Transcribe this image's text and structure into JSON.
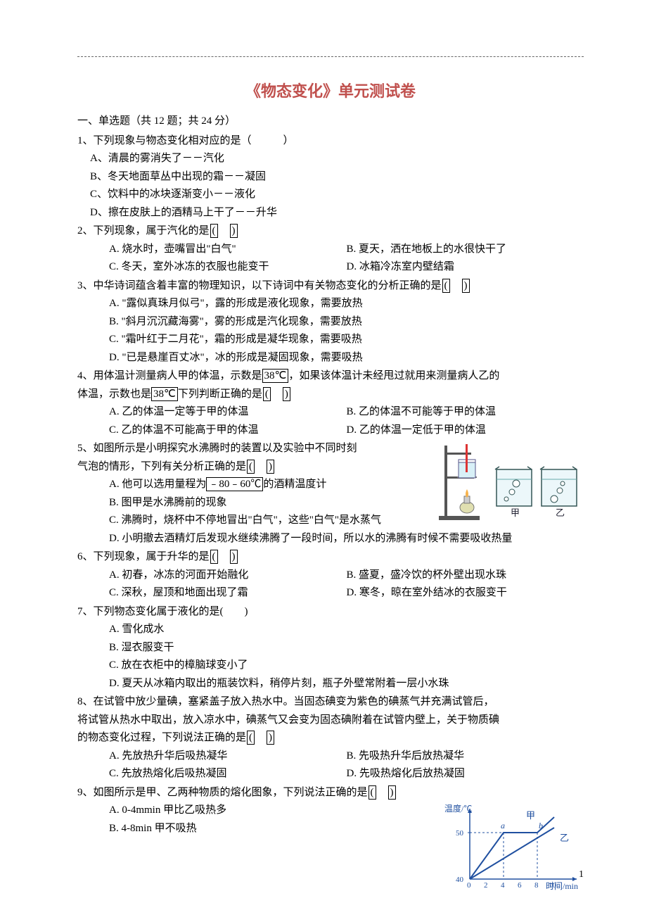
{
  "title": "《物态变化》单元测试卷",
  "section1": "一、单选题（共 12 题；共 24 分）",
  "q1": {
    "stem": "1、下列现象与物态变化相对应的是（　　　）",
    "a": "A、清晨的雾消失了－－汽化",
    "b": "B、冬天地面草丛中出现的霜－－凝固",
    "c": "C、饮料中的冰块逐渐变小－－液化",
    "d": "D、擦在皮肤上的酒精马上干了－－升华"
  },
  "q2": {
    "stem_pre": "2、下列现象，属于汽化的是",
    "a": "A. 烧水时，壶嘴冒出\"白气\"",
    "b": "B. 夏天，洒在地板上的水很快干了",
    "c": "C. 冬天，室外冰冻的衣服也能变干",
    "d": "D. 冰箱冷冻室内壁结霜"
  },
  "q3": {
    "stem_pre": "3、中华诗词蕴含着丰富的物理知识，以下诗词中有关物态变化的分析正确的是",
    "a": "A. \"露似真珠月似弓\"，露的形成是液化现象，需要放热",
    "b": "B. \"斜月沉沉藏海雾\"，雾的形成是汽化现象，需要放热",
    "c": "C. \"霜叶红于二月花\"，霜的形成是凝华现象，需要吸热",
    "d": "D. \"已是悬崖百丈冰\"，冰的形成是凝固现象，需要吸热"
  },
  "q4": {
    "stem_pre1": "4、用体温计测量病人甲的体温，示数是",
    "temp1": "38℃",
    "stem_mid1": "，如果该体温计未经甩过就用来测量病人乙的",
    "stem_pre2": "体温，示数也是",
    "temp2": "38℃",
    "stem_mid2": "下列判断正确的是",
    "a": "A. 乙的体温一定等于甲的体温",
    "b": "B. 乙的体温不可能等于甲的体温",
    "c": "C. 乙的体温不可能高于甲的体温",
    "d": "D. 乙的体温一定低于甲的体温"
  },
  "q5": {
    "stem1": "5、如图所示是小明探究水沸腾时的装置以及实验中不同时刻",
    "stem2_pre": "气泡的情形，下列有关分析正确的是",
    "a_pre": "A. 他可以选用量程为",
    "range": "﹣80﹣60℃",
    "a_post": "的酒精温度计",
    "b": "B. 图甲是水沸腾前的现象",
    "c": "C. 沸腾时，烧杯中不停地冒出\"白气\"，这些\"白气\"是水蒸气",
    "d": "D. 小明撤去酒精灯后发现水继续沸腾了一段时间，所以水的沸腾有时候不需要吸收热量",
    "fig_jia": "甲",
    "fig_yi": "乙"
  },
  "q6": {
    "stem_pre": "6、下列现象，属于升华的是",
    "a": "A. 初春，冰冻的河面开始融化",
    "b": "B. 盛夏，盛冷饮的杯外壁出现水珠",
    "c": "C. 深秋，屋顶和地面出现了霜",
    "d": "D. 寒冬，晾在室外结冰的衣服变干"
  },
  "q7": {
    "stem": "7、下列物态变化属于液化的是(　　)",
    "a": "A. 雪化成水",
    "b": "B. 湿衣服变干",
    "c": "C. 放在衣柜中的樟脑球变小了",
    "d": "D. 夏天从冰箱内取出的瓶装饮料，稍停片刻，瓶子外壁常附着一层小水珠"
  },
  "q8": {
    "stem1": "8、在试管中放少量碘，塞紧盖子放入热水中。当固态碘变为紫色的碘蒸气并充满试管后，",
    "stem2": "将试管从热水中取出，放入凉水中，碘蒸气又会变为固态碘附着在试管内壁上，关于物质碘",
    "stem3_pre": "的物态变化过程，下列说法正确的是",
    "a": "A. 先放热升华后吸热凝华",
    "b": "B. 先吸热升华后放热凝华",
    "c": "C. 先放热熔化后吸热凝固",
    "d": "D. 先吸热熔化后放热凝固"
  },
  "q9": {
    "stem_pre": "9、如图所示是甲、乙两种物质的熔化图象，下列说法正确的是",
    "a": "A. 0-4mmin 甲比乙吸热多",
    "b": "B. 4-8min 甲不吸热",
    "chart": {
      "ylabel": "温度/℃",
      "xlabel": "时间/min",
      "jia": "甲",
      "yi": "乙",
      "a_mark": "a",
      "b_mark": "b"
    }
  },
  "page_num": "1",
  "chart_data": {
    "type": "line",
    "xlabel": "时间/min",
    "ylabel": "温度/℃",
    "x_ticks": [
      0,
      2,
      4,
      6,
      8,
      10
    ],
    "y_ticks": [
      40,
      50
    ],
    "series": [
      {
        "name": "甲",
        "x": [
          0,
          4,
          8,
          10
        ],
        "y": [
          40,
          50,
          50,
          55
        ]
      },
      {
        "name": "乙",
        "x": [
          0,
          10
        ],
        "y": [
          40,
          51
        ]
      }
    ],
    "annotations": [
      {
        "label": "a",
        "x": 4,
        "y": 50
      },
      {
        "label": "b",
        "x": 8,
        "y": 50
      }
    ]
  }
}
